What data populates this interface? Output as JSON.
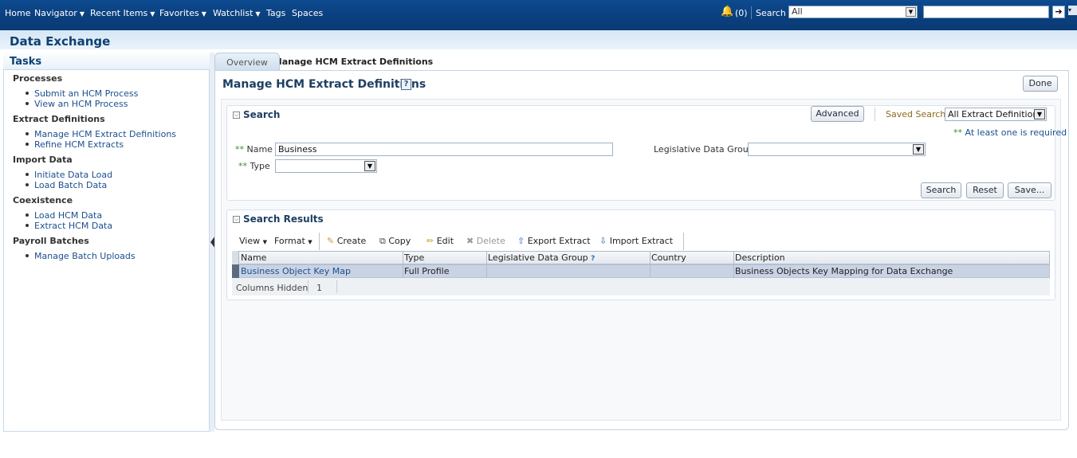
{
  "topbar": {
    "nav": [
      {
        "label": "Home",
        "caret": false
      },
      {
        "label": "Navigator",
        "caret": true
      },
      {
        "label": "Recent Items",
        "caret": true
      },
      {
        "label": "Favorites",
        "caret": true
      },
      {
        "label": "Watchlist",
        "caret": true
      },
      {
        "label": "Tags",
        "caret": false
      },
      {
        "label": "Spaces",
        "caret": false
      }
    ],
    "notifications": "(0)",
    "search_label": "Search",
    "search_scope": "All",
    "search_value": ""
  },
  "app": {
    "title": "Data Exchange"
  },
  "tasks": {
    "title": "Tasks",
    "groups": [
      {
        "label": "Processes",
        "items": [
          "Submit an HCM Process",
          "View an HCM Process"
        ]
      },
      {
        "label": "Extract Definitions",
        "items": [
          "Manage HCM Extract Definitions",
          "Refine HCM Extracts"
        ]
      },
      {
        "label": "Import Data",
        "items": [
          "Initiate Data Load",
          "Load Batch Data"
        ]
      },
      {
        "label": "Coexistence",
        "items": [
          "Load HCM Data",
          "Extract HCM Data"
        ]
      },
      {
        "label": "Payroll Batches",
        "items": [
          "Manage Batch Uploads"
        ]
      }
    ]
  },
  "tabs": {
    "overview": "Overview",
    "manage": "Manage HCM Extract Definitions"
  },
  "page": {
    "title": "Manage HCM Extract Definitions",
    "help": "?",
    "done": "Done"
  },
  "search": {
    "title": "Search",
    "advanced": "Advanced",
    "saved_search_label": "Saved Search",
    "saved_search_value": "All Extract Definitions",
    "required_marker": "**",
    "required_note": "At least one is required",
    "name_label": "Name",
    "name_value": "Business",
    "type_label": "Type",
    "type_value": "",
    "ldg_label": "Legislative Data Group",
    "ldg_value": "",
    "buttons": {
      "search": "Search",
      "reset": "Reset",
      "save": "Save..."
    }
  },
  "results": {
    "title": "Search Results",
    "toolbar": {
      "view": "View",
      "format": "Format",
      "create": "Create",
      "copy": "Copy",
      "edit": "Edit",
      "delete": "Delete",
      "export": "Export Extract",
      "import": "Import Extract"
    },
    "columns": [
      "Name",
      "Type",
      "Legislative Data Group",
      "Country",
      "Description"
    ],
    "rows": [
      {
        "name": "Business Object Key Map",
        "type": "Full Profile",
        "ldg": "",
        "country": "",
        "description": "Business Objects Key Mapping for Data Exchange"
      }
    ],
    "columns_hidden_label": "Columns Hidden",
    "columns_hidden_count": "1"
  }
}
